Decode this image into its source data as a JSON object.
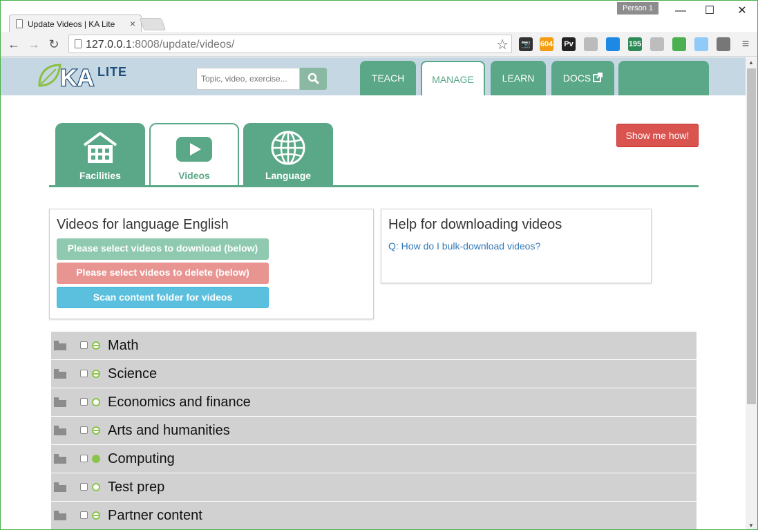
{
  "browser": {
    "tab_title": "Update Videos | KA Lite",
    "tab_close": "×",
    "person": "Person 1",
    "window_controls": {
      "minimize": "—",
      "maximize": "☐",
      "close": "✕"
    },
    "url_host": "127.0.0.1",
    "url_rest": ":8008/update/videos/",
    "star_glyph": "☆",
    "back_glyph": "←",
    "forward_glyph": "→",
    "reload_glyph": "↻",
    "menu_glyph": "≡",
    "extensions": [
      {
        "icon": "camera-icon",
        "text": "📷",
        "color": "#333333"
      },
      {
        "icon": "rss-icon",
        "text": "604",
        "color": "#f39c12"
      },
      {
        "icon": "pv-icon",
        "text": "Pv",
        "color": "#222222"
      },
      {
        "icon": "puzzle-icon",
        "text": "",
        "color": "#bbbbbb"
      },
      {
        "icon": "stripe-icon",
        "text": "",
        "color": "#1e88e5"
      },
      {
        "icon": "counter-icon",
        "text": "195",
        "color": "#2e8b57"
      },
      {
        "icon": "clock-icon",
        "text": "",
        "color": "#bdbdbd"
      },
      {
        "icon": "grammar-icon",
        "text": "",
        "color": "#4caf50"
      },
      {
        "icon": "window-icon",
        "text": "",
        "color": "#90caf9"
      },
      {
        "icon": "gear-icon",
        "text": "",
        "color": "#777777"
      }
    ]
  },
  "header": {
    "logo_text": "KA LITE",
    "search_placeholder": "Topic, video, exercise...",
    "nav": [
      {
        "label": "TEACH",
        "active": false
      },
      {
        "label": "MANAGE",
        "active": true
      },
      {
        "label": "LEARN",
        "active": false
      },
      {
        "label": "DOCS",
        "active": false
      },
      {
        "label": "",
        "active": false
      }
    ]
  },
  "show_me_how": "Show me how!",
  "subtabs": [
    {
      "label": "Facilities",
      "icon": "building-icon",
      "active": false
    },
    {
      "label": "Videos",
      "icon": "play-icon",
      "active": true
    },
    {
      "label": "Language",
      "icon": "globe-icon",
      "active": false
    }
  ],
  "videos_panel": {
    "title": "Videos for language English",
    "download_label": "Please select videos to download (below)",
    "delete_label": "Please select videos to delete (below)",
    "scan_label": "Scan content folder for videos",
    "colors": {
      "download": "#8fc9af",
      "delete": "#e89592",
      "scan": "#5bc0de"
    }
  },
  "help_panel": {
    "title": "Help for downloading videos",
    "link": "Q: How do I bulk-download videos?"
  },
  "topics": [
    {
      "label": "Math",
      "status": "partial"
    },
    {
      "label": "Science",
      "status": "partial"
    },
    {
      "label": "Economics and finance",
      "status": "empty"
    },
    {
      "label": "Arts and humanities",
      "status": "partial"
    },
    {
      "label": "Computing",
      "status": "full"
    },
    {
      "label": "Test prep",
      "status": "empty"
    },
    {
      "label": "Partner content",
      "status": "partial"
    }
  ]
}
